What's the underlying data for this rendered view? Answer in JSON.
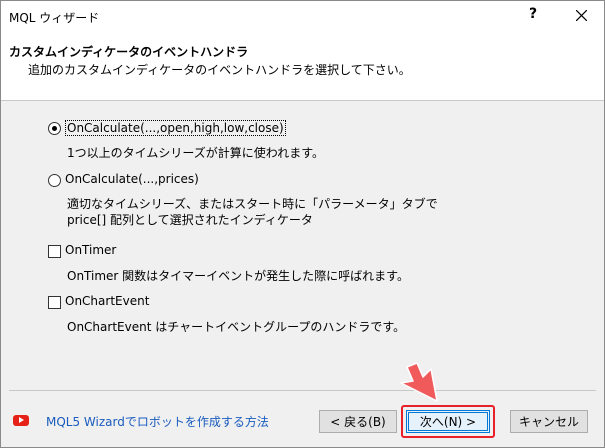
{
  "window": {
    "title": "MQL ウィザード",
    "help": "?",
    "close_icon": "close-icon"
  },
  "header": {
    "title": "カスタムインディケータのイベントハンドラ",
    "subtitle": "追加のカスタムインディケータのイベントハンドラを選択して下さい。"
  },
  "options": [
    {
      "type": "radio",
      "checked": true,
      "label": "OnCalculate(...,open,high,low,close)",
      "desc": [
        "1つ以上のタイムシリーズが計算に使われます。"
      ]
    },
    {
      "type": "radio",
      "checked": false,
      "label": "OnCalculate(...,prices)",
      "desc": [
        "適切なタイムシリーズ、またはスタート時に「パラーメータ」タブで",
        "price[] 配列として選択されたインディケータ"
      ]
    },
    {
      "type": "checkbox",
      "checked": false,
      "label": "OnTimer",
      "desc": [
        "OnTimer 関数はタイマーイベントが発生した際に呼ばれます。"
      ]
    },
    {
      "type": "checkbox",
      "checked": false,
      "label": "OnChartEvent",
      "desc": [
        "OnChartEvent はチャートイベントグループのハンドラです。"
      ]
    }
  ],
  "footer": {
    "help_icon": "youtube-icon",
    "help_link": "MQL5 Wizardでロボットを作成する方法",
    "back": "< 戻る(B)",
    "next": "次へ(N) >",
    "cancel": "キャンセル"
  },
  "colors": {
    "link": "#1a5bbf",
    "highlight": "#e8202a",
    "accent": "#0078d7"
  }
}
